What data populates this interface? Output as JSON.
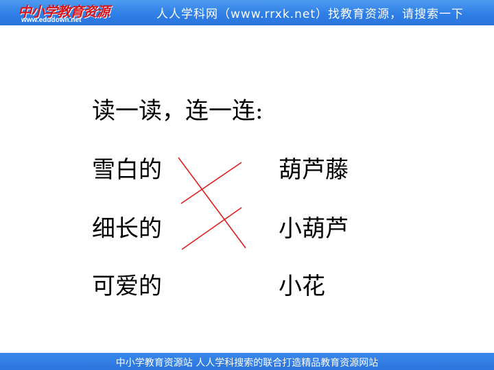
{
  "header": {
    "logo_text": "中小学教育资源",
    "logo_url": "www.edudown.net",
    "slogan": "人人学科网（www.rrxk.net）找教育资源，请搜索一下"
  },
  "exercise": {
    "title": "读一读，连一连:",
    "left_items": [
      "雪白的",
      "细长的",
      "可爱的"
    ],
    "right_items": [
      "葫芦藤",
      "小葫芦",
      "小花"
    ],
    "answer_line_color": "#e11c1c"
  },
  "footer": {
    "text": "中小学教育资源站 人人学科搜索的联合打造精品教育资源网站"
  }
}
